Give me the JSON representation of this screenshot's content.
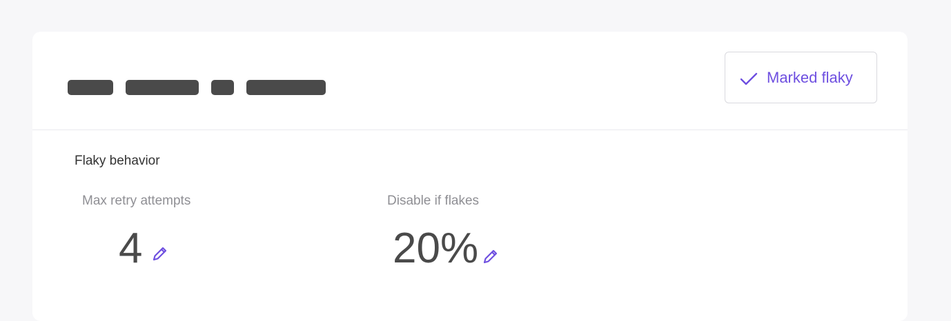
{
  "header": {
    "flaky_button": {
      "label": "Marked flaky",
      "icon": "check-icon",
      "color": "#6e4fe0"
    }
  },
  "section": {
    "title": "Flaky behavior",
    "fields": [
      {
        "label": "Max retry attempts",
        "value": "4",
        "icon": "pencil-icon"
      },
      {
        "label": "Disable if flakes",
        "value": "20%",
        "icon": "pencil-icon"
      }
    ]
  },
  "colors": {
    "accent": "#6e4fe0",
    "value_text": "#4a4a4a",
    "label_text": "#8f8f94",
    "page_background": "#f7f7f9"
  }
}
